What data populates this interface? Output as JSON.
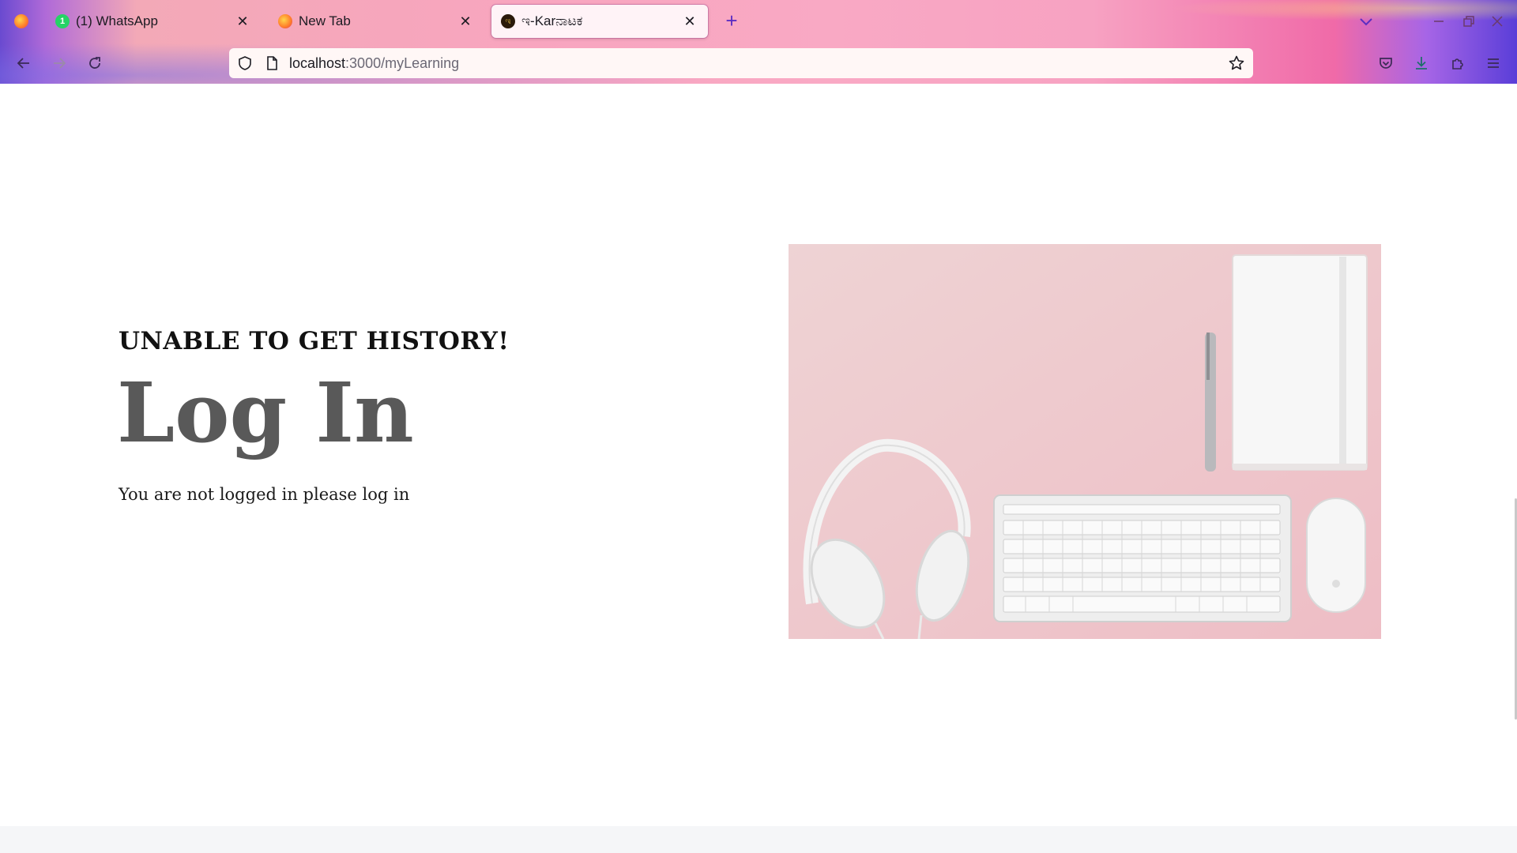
{
  "browser": {
    "tabs": [
      {
        "title": "(1) WhatsApp",
        "favicon": "whatsapp-icon",
        "badge": "1",
        "active": false
      },
      {
        "title": "New Tab",
        "favicon": "firefox-icon",
        "active": false
      },
      {
        "title": "ಇ-Karನಾಟಕ",
        "favicon": "ekarnataka-icon",
        "active": true
      }
    ],
    "url_host": "localhost",
    "url_path": ":3000/myLearning",
    "accent_color": "#5b2ec2"
  },
  "main": {
    "subtitle": "UNABLE TO GET HISTORY!",
    "heading": "Log In",
    "message": "You are not logged in please log in",
    "image": {
      "subject": "pink desk flat-lay with headphones, pen, notebook, keyboard and mouse",
      "background_color": "#efc8cd"
    }
  }
}
